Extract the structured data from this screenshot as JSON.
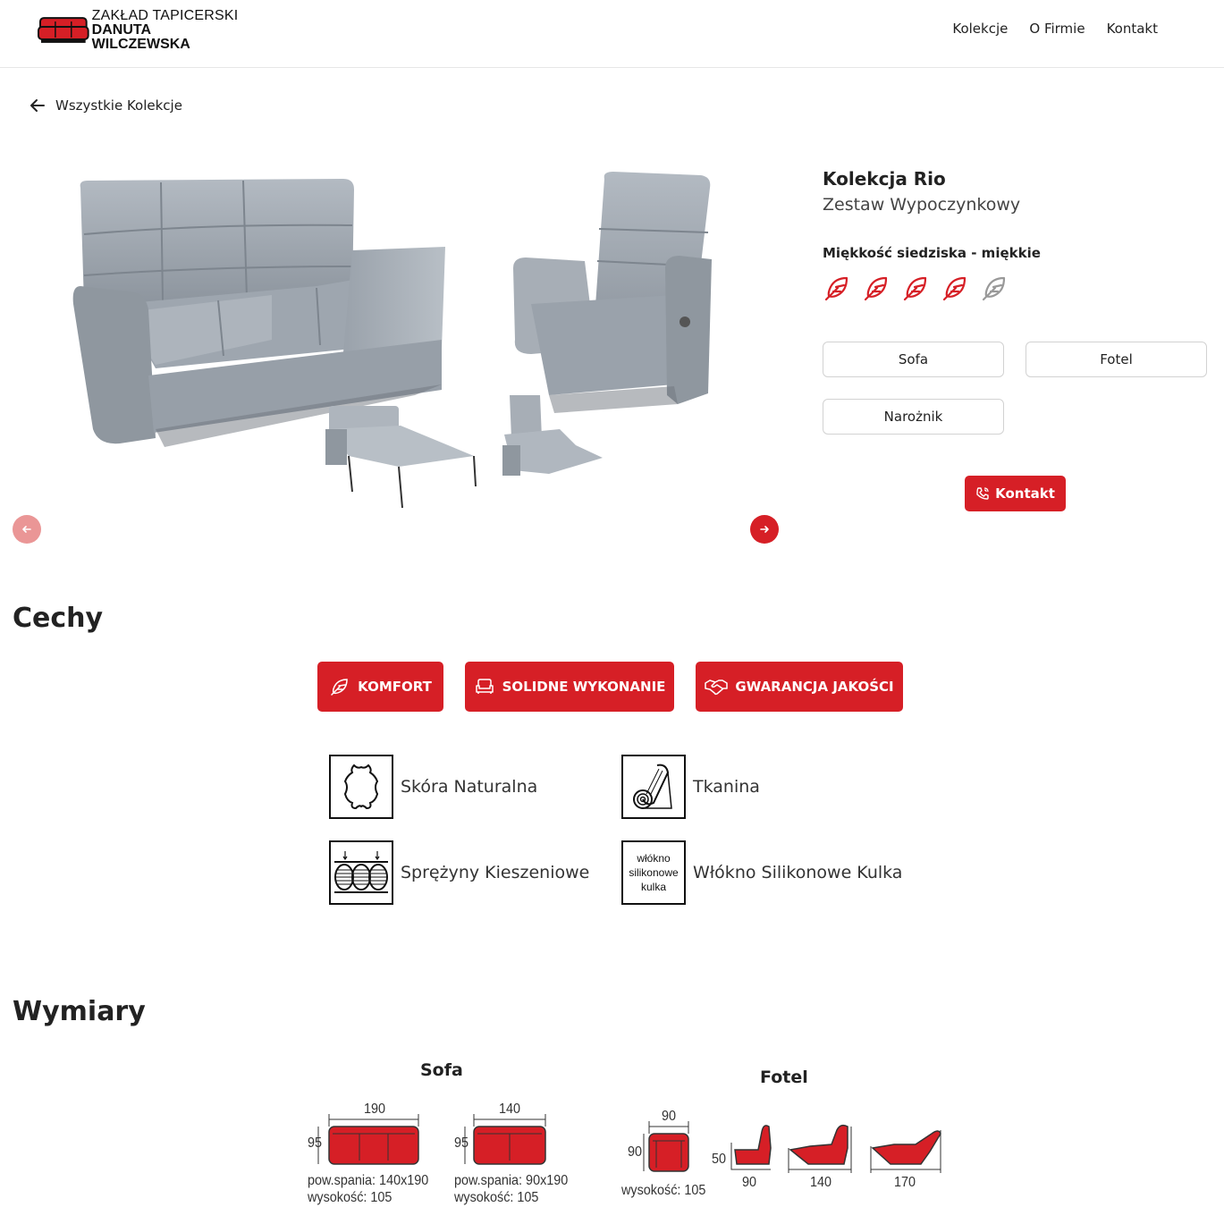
{
  "brand": {
    "line1": "ZAKŁAD TAPICERSKI",
    "line2": "DANUTA WILCZEWSKA"
  },
  "nav": [
    "Kolekcje",
    "O Firmie",
    "Kontakt"
  ],
  "back": {
    "label": "Wszystkie Kolekcje"
  },
  "product": {
    "title": "Kolekcja Rio",
    "subtitle": "Zestaw Wypoczynkowy",
    "softness_label": "Miękkość siedziska - miękkie",
    "softness_level": 4,
    "softness_max": 5,
    "variants": [
      "Sofa",
      "Fotel",
      "Narożnik"
    ],
    "contact_label": "Kontakt"
  },
  "colors": {
    "accent": "#d61f26",
    "accent_light": "#ea9696"
  },
  "features": {
    "title": "Cechy",
    "buttons": [
      {
        "label": "KOMFORT",
        "icon": "feather-icon"
      },
      {
        "label": "SOLIDNE WYKONANIE",
        "icon": "armchair-icon"
      },
      {
        "label": "GWARANCJA JAKOŚCI",
        "icon": "handshake-icon"
      }
    ],
    "materials": [
      {
        "label": "Skóra Naturalna",
        "icon": "leather-hide-icon"
      },
      {
        "label": "Tkanina",
        "icon": "fabric-roll-icon"
      },
      {
        "label": "Sprężyny Kieszeniowe",
        "icon": "pocket-springs-icon"
      },
      {
        "label": "Włókno Silikonowe Kulka",
        "icon": "silicone-fiber-icon",
        "icon_text": [
          "włókno",
          "silikonowe",
          "kulka"
        ]
      }
    ]
  },
  "dimensions": {
    "title": "Wymiary",
    "sofa": {
      "title": "Sofa",
      "items": [
        {
          "width": "190",
          "depth": "95",
          "note1": "pow.spania: 140x190",
          "note2": "wysokość: 105"
        },
        {
          "width": "140",
          "depth": "95",
          "note1": "pow.spania: 90x190",
          "note2": "wysokość: 105"
        }
      ]
    },
    "fotel": {
      "title": "Fotel",
      "width": "90",
      "depth": "90",
      "note": "wysokość: 105",
      "recline_height": "50",
      "recline_lengths": [
        "90",
        "140",
        "170"
      ]
    }
  }
}
